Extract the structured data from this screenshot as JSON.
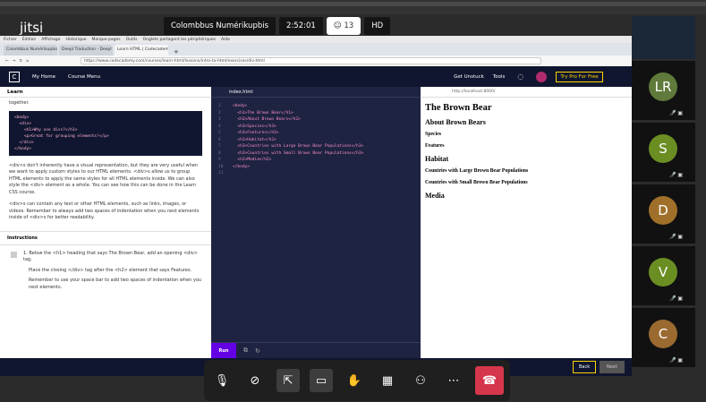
{
  "meeting": {
    "logo": "jitsi",
    "title": "Colombbus Numérikupbis",
    "timer": "2:52:01",
    "participants_count": "13",
    "quality": "HD"
  },
  "browser": {
    "menu": [
      "Fichier",
      "Édition",
      "Affichage",
      "Historique",
      "Marque-pages",
      "Outils",
      "Onglets partagent les périphériques",
      "Aide"
    ],
    "tabs": [
      "Colombbus Numérikupbis",
      "Deepl Traduction - Deepl Tra",
      "Learn HTML | Codecademy"
    ],
    "url": "https://www.codecademy.com/courses/learn-html/lessons/intro-to-html/exercises/div-html",
    "preview_url": "http://localhost:8000/"
  },
  "codecademy": {
    "logo": "C",
    "nav": [
      "My Home",
      "Course Menu"
    ],
    "get_unstuck": "Get Unstuck",
    "tools": "Tools",
    "pro_button": "Try Pro For Free",
    "learn_label": "Learn",
    "learn_intro": "together.",
    "code_example": [
      "<body>",
      "  <div>",
      "    <h1>Why use divs?</h1>",
      "    <p>Great for grouping elements!</p>",
      "  </div>",
      "</body>"
    ],
    "para1": "<div>s don't inherently have a visual representation, but they are very useful when we want to apply custom styles to our HTML elements. <div>s allow us to group HTML elements to apply the same styles for all HTML elements inside. We can also style the <div> element as a whole. You can see how this can be done in the Learn CSS course.",
    "para2": "<div>s can contain any text or other HTML elements, such as links, images, or videos. Remember to always add two spaces of indentation when you nest elements inside of <div>s for better readability.",
    "instructions_label": "Instructions",
    "step_number": "1.",
    "step1": "Below the <h1> heading that says The Brown Bear, add an opening <div> tag.",
    "step2": "Place the closing </div> tag after the <h2> element that says Features.",
    "step3": "Remember to use your space bar to add two spaces of indentation when you nest elements.",
    "file_tab": "index.html",
    "code_lines": [
      {
        "n": "1",
        "text": "<body>"
      },
      {
        "n": "2",
        "text": "  <h1>The Brown Bear</h1>"
      },
      {
        "n": "3",
        "text": "  <h2>About Brown Bears</h2>"
      },
      {
        "n": "4",
        "text": "  <h3>Species</h3>"
      },
      {
        "n": "5",
        "text": "  <h3>Features</h3>"
      },
      {
        "n": "6",
        "text": "  <h2>Habitat</h2>"
      },
      {
        "n": "7",
        "text": "  <h3>Countries with Large Brown Bear Populations</h3>"
      },
      {
        "n": "8",
        "text": "  <h3>Countries with Small Brown Bear Populations</h3>"
      },
      {
        "n": "9",
        "text": "  <h2>Media</h2>"
      },
      {
        "n": "10",
        "text": "</body>"
      },
      {
        "n": "11",
        "text": ""
      }
    ],
    "run_button": "Run",
    "back_button": "Back",
    "next_button": "Next"
  },
  "preview": {
    "h1": "The Brown Bear",
    "h2a": "About Brown Bears",
    "h3a": "Species",
    "h3b": "Features",
    "h2b": "Habitat",
    "h3c": "Countries with Large Brown Bear Populations",
    "h3d": "Countries with Small Brown Bear Populations",
    "h2c": "Media"
  },
  "participants": [
    {
      "initials": "LR",
      "color": "#5f7a3a"
    },
    {
      "initials": "S",
      "color": "#6b8e23"
    },
    {
      "initials": "D",
      "color": "#a0702a"
    },
    {
      "initials": "V",
      "color": "#6b8e23"
    },
    {
      "initials": "C",
      "color": "#9a6a30"
    }
  ],
  "colors": {
    "hangup": "#d6364b",
    "run": "#6400e4",
    "pro": "#ffd300",
    "codecademy_navy": "#10162f"
  }
}
